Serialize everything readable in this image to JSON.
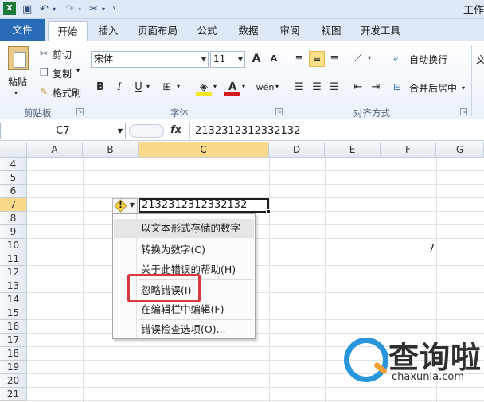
{
  "window": {
    "title": "工作"
  },
  "qat": {
    "icons": [
      "excel-icon",
      "save-icon",
      "undo-icon",
      "redo-icon",
      "customize-icon"
    ]
  },
  "tabs": [
    {
      "label": "文件"
    },
    {
      "label": "开始"
    },
    {
      "label": "插入"
    },
    {
      "label": "页面布局"
    },
    {
      "label": "公式"
    },
    {
      "label": "数据"
    },
    {
      "label": "审阅"
    },
    {
      "label": "视图"
    },
    {
      "label": "开发工具"
    }
  ],
  "ribbon": {
    "clipboard": {
      "paste": "粘贴",
      "cut": "剪切",
      "copy": "复制",
      "format_painter": "格式刷",
      "label": "剪贴板"
    },
    "font": {
      "name": "宋体",
      "size": "11",
      "grow": "A",
      "shrink": "A",
      "bold": "B",
      "italic": "I",
      "underline": "U",
      "phonetic": "wén",
      "label": "字体"
    },
    "alignment": {
      "wrap": "自动换行",
      "merge": "合并后居中",
      "label": "对齐方式"
    },
    "number_partial": "文"
  },
  "formula_bar": {
    "name_box": "C7",
    "fx": "fx",
    "value": "2132312312332132"
  },
  "columns": [
    "A",
    "B",
    "C",
    "D",
    "E",
    "F",
    "G"
  ],
  "rows": [
    "4",
    "5",
    "6",
    "7",
    "8",
    "9",
    "10",
    "11",
    "12",
    "13",
    "14",
    "15",
    "16",
    "17",
    "18",
    "19",
    "20",
    "21"
  ],
  "cells": {
    "c7": "2132312312332132",
    "f10": "7"
  },
  "error_menu": {
    "header": "以文本形式存储的数字",
    "items": [
      "转换为数字(C)",
      "关于此错误的帮助(H)",
      "忽略错误(I)",
      "在编辑栏中编辑(F)",
      "错误检查选项(O)..."
    ]
  },
  "watermark": {
    "brand": "查询啦",
    "url": "chaxunla.com"
  },
  "colors": {
    "file_tab": "#2a6bb8",
    "active_header": "#f9d98a",
    "highlight": "#d9383e",
    "wm_blue": "#2996dc",
    "wm_orange": "#f3a133"
  }
}
